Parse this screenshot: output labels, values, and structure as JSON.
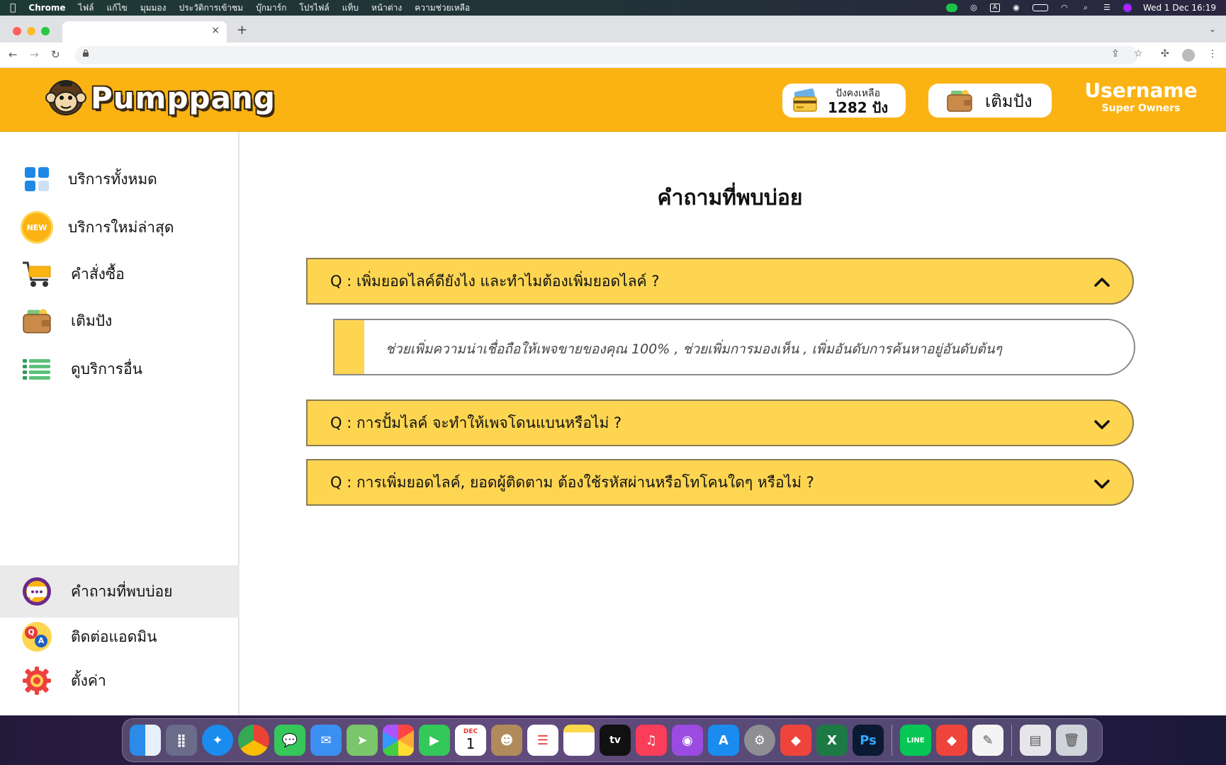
{
  "menubar": {
    "app": "Chrome",
    "items": [
      "ไฟล์",
      "แก้ไข",
      "มุมมอง",
      "ประวัติการเข้าชม",
      "บุ๊กมาร์ก",
      "โปรไฟล์",
      "แท็บ",
      "หน้าต่าง",
      "ความช่วยเหลือ"
    ],
    "clock": "Wed 1 Dec  16:19",
    "input_source": "A"
  },
  "browser": {
    "tab_close": "×",
    "new_tab": "+",
    "tab_menu": "⌄"
  },
  "header": {
    "logo_text": "Pumppang",
    "balance_label": "ปังคงเหลือ",
    "balance_value": "1282 ปัง",
    "topup_label": "เติมปัง",
    "username": "Username",
    "role": "Super Owners",
    "brand_color": "#fbb313"
  },
  "sidebar": {
    "items": [
      {
        "label": "บริการทั้งหมด",
        "icon": "grid-icon"
      },
      {
        "label": "บริการใหม่ล่าสุด",
        "icon": "new-badge-icon",
        "badge": "NEW"
      },
      {
        "label": "คำสั่งซื้อ",
        "icon": "cart-icon"
      },
      {
        "label": "เติมปัง",
        "icon": "wallet-icon"
      },
      {
        "label": "ดูบริการอื่น",
        "icon": "list-icon"
      }
    ],
    "bottom_items": [
      {
        "label": "คำถามที่พบบ่อย",
        "icon": "chat-bubble-icon",
        "active": true
      },
      {
        "label": "ติดต่อแอดมิน",
        "icon": "qa-icon",
        "badge_q": "Q",
        "badge_a": "A"
      },
      {
        "label": "ตั้งค่า",
        "icon": "gear-icon"
      }
    ]
  },
  "main": {
    "title": "คำถามที่พบบ่อย",
    "faqs": [
      {
        "question": "Q : เพิ่มยอดไลค์ดียังไง และทำไมต้องเพิ่มยอดไลค์ ?",
        "expanded": true,
        "answer": "ช่วยเพิ่มความน่าเชื่อถือให้เพจขายของคุณ 100% , ช่วยเพิ่มการมองเห็น , เพิ่มอันดับการค้นหาอยู่อันดับต้นๆ"
      },
      {
        "question": "Q : การปั้มไลค์ จะทำให้เพจโดนแบนหรือไม่ ?",
        "expanded": false
      },
      {
        "question": "Q : การเพิ่มยอดไลค์, ยอดผู้ติดตาม ต้องใช้รหัสผ่านหรือโทโคนใดๆ หรือไม่ ?",
        "expanded": false
      }
    ],
    "faq_color": "#fdd551"
  },
  "dock": {
    "apps": [
      "finder-icon",
      "launchpad-icon",
      "safari-icon",
      "chrome-icon",
      "messages-icon",
      "mail-icon",
      "maps-icon",
      "photos-icon",
      "facetime-icon",
      "calendar-icon",
      "contacts-icon",
      "reminders-icon",
      "notes-icon",
      "tv-icon",
      "music-icon",
      "podcasts-icon",
      "app-store-icon",
      "system-preferences-icon",
      "anydesk-icon",
      "excel-icon",
      "photoshop-icon",
      "line-icon",
      "anydesk-2-icon",
      "textedit-icon",
      "downloads-icon",
      "trash-icon"
    ],
    "calendar_month": "DEC",
    "calendar_day": "1",
    "tv_label": "tv",
    "excel_label": "X",
    "photoshop_label": "Ps",
    "line_label": "LINE"
  }
}
